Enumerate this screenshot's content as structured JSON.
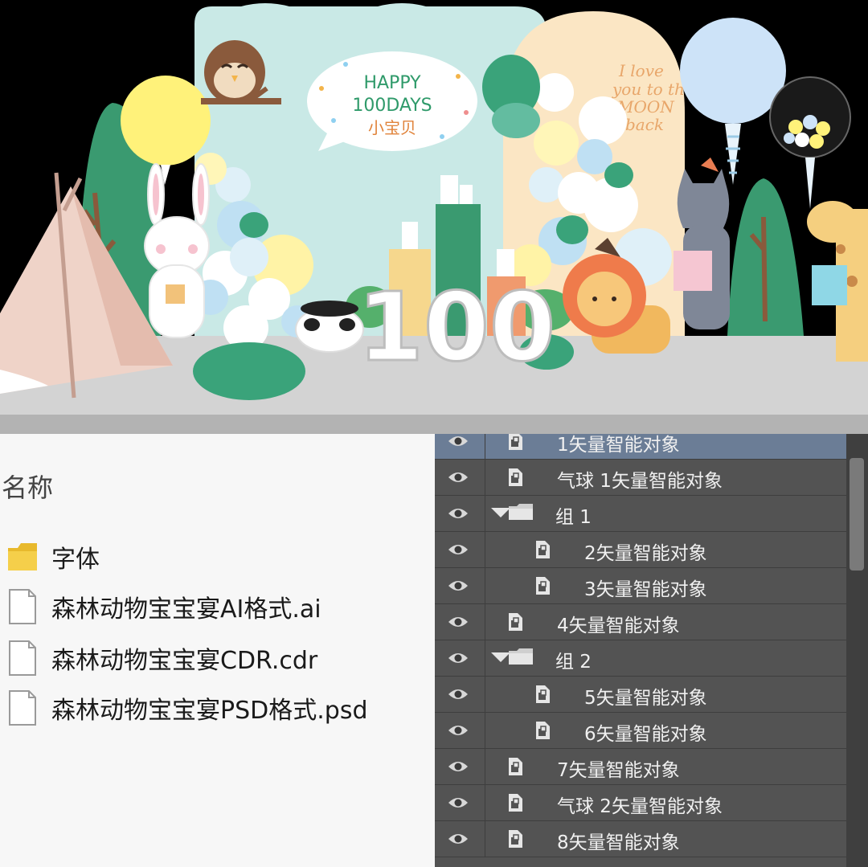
{
  "scene": {
    "bubble_line1": "HAPPY",
    "bubble_line2": "100DAYS",
    "bubble_line3": "小宝贝",
    "big_number": "100",
    "colors": {
      "backdrop_mint": "#c9e9e6",
      "arch_cream": "#fbe6c4",
      "floor": "#d3d3d3",
      "green": "#3a9a70"
    }
  },
  "file_explorer": {
    "column_header": "名称",
    "items": [
      {
        "name": "字体",
        "icon": "folder-icon"
      },
      {
        "name": "森林动物宝宝宴AI格式.ai",
        "icon": "file-icon"
      },
      {
        "name": "森林动物宝宝宴CDR.cdr",
        "icon": "file-icon"
      },
      {
        "name": "森林动物宝宝宴PSD格式.psd",
        "icon": "file-icon"
      }
    ]
  },
  "layers_panel": {
    "layers": [
      {
        "name": "1矢量智能对象",
        "type": "smart-object",
        "indent": 0,
        "selected": true
      },
      {
        "name": "气球 1矢量智能对象",
        "type": "smart-object",
        "indent": 0
      },
      {
        "name": "组 1",
        "type": "group",
        "indent": 0
      },
      {
        "name": "2矢量智能对象",
        "type": "smart-object",
        "indent": 1
      },
      {
        "name": "3矢量智能对象",
        "type": "smart-object",
        "indent": 1
      },
      {
        "name": "4矢量智能对象",
        "type": "smart-object",
        "indent": 0
      },
      {
        "name": "组 2",
        "type": "group",
        "indent": 0
      },
      {
        "name": "5矢量智能对象",
        "type": "smart-object",
        "indent": 1
      },
      {
        "name": "6矢量智能对象",
        "type": "smart-object",
        "indent": 1
      },
      {
        "name": "7矢量智能对象",
        "type": "smart-object",
        "indent": 0
      },
      {
        "name": "气球 2矢量智能对象",
        "type": "smart-object",
        "indent": 0
      },
      {
        "name": "8矢量智能对象",
        "type": "smart-object",
        "indent": 0
      }
    ]
  }
}
